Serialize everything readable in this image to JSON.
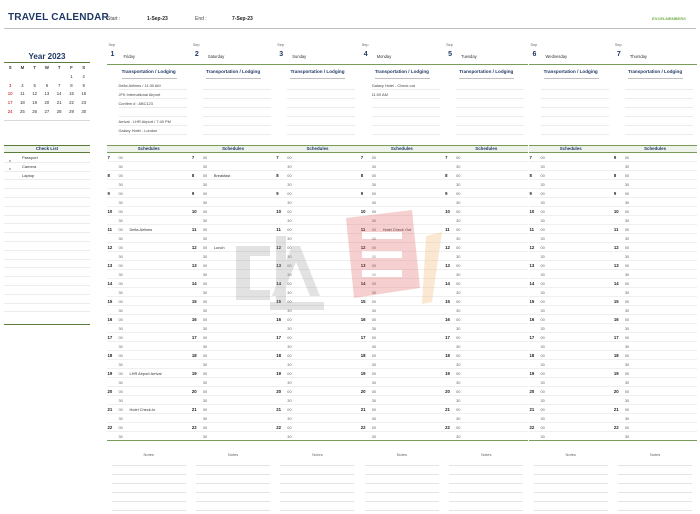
{
  "header": {
    "title": "TRAVEL CALENDAR",
    "start_label": "Start :",
    "start_value": "1-Sep-23",
    "end_label": "End :",
    "end_value": "7-Sep-23",
    "brand": "EXCELMEMBERS"
  },
  "minical": {
    "title": "Year 2023",
    "dow": [
      "S",
      "M",
      "T",
      "W",
      "T",
      "F",
      "S"
    ],
    "weeks": [
      [
        "",
        "",
        "",
        "",
        "",
        "1",
        "2"
      ],
      [
        "3",
        "4",
        "5",
        "6",
        "7",
        "8",
        "9"
      ],
      [
        "10",
        "11",
        "12",
        "13",
        "14",
        "15",
        "16"
      ],
      [
        "17",
        "18",
        "19",
        "20",
        "21",
        "22",
        "23"
      ],
      [
        "24",
        "25",
        "26",
        "27",
        "28",
        "29",
        "30"
      ]
    ]
  },
  "checklist": {
    "title": "Check List",
    "items": [
      {
        "mark": "x",
        "text": "Passport"
      },
      {
        "mark": "x",
        "text": "Camera"
      },
      {
        "mark": "",
        "text": "Laptop"
      }
    ]
  },
  "labels": {
    "transport": "Transportation / Lodging",
    "schedules": "Schedules",
    "notes": "Notes"
  },
  "days": [
    {
      "month": "Sep",
      "num": "1",
      "name": "Friday",
      "transport": [
        "Delta Airlines / 11:30 AM",
        "JFK International Airport",
        "Confirm # : ABC123",
        "",
        "Arrival - LHR Airport / 7:40 PM",
        "Galaxy Hotel - London"
      ],
      "hours": [
        [
          "7",
          "00",
          ""
        ],
        [
          "",
          "30",
          ""
        ],
        [
          "8",
          "00",
          ""
        ],
        [
          "",
          "30",
          ""
        ],
        [
          "9",
          "00",
          ""
        ],
        [
          "",
          "30",
          ""
        ],
        [
          "10",
          "00",
          ""
        ],
        [
          "",
          "30",
          ""
        ],
        [
          "11",
          "00",
          "Delta Airlines"
        ],
        [
          "",
          "30",
          ""
        ],
        [
          "12",
          "00",
          ""
        ],
        [
          "",
          "30",
          ""
        ],
        [
          "13",
          "00",
          ""
        ],
        [
          "",
          "30",
          ""
        ],
        [
          "14",
          "00",
          ""
        ],
        [
          "",
          "30",
          ""
        ],
        [
          "15",
          "00",
          ""
        ],
        [
          "",
          "30",
          ""
        ],
        [
          "16",
          "00",
          ""
        ],
        [
          "",
          "30",
          ""
        ],
        [
          "17",
          "00",
          ""
        ],
        [
          "",
          "30",
          ""
        ],
        [
          "18",
          "00",
          ""
        ],
        [
          "",
          "30",
          ""
        ],
        [
          "19",
          "00",
          "LHR Airport Arrival"
        ],
        [
          "",
          "30",
          ""
        ],
        [
          "20",
          "00",
          ""
        ],
        [
          "",
          "30",
          ""
        ],
        [
          "21",
          "00",
          "Hotel Check-In"
        ],
        [
          "",
          "30",
          ""
        ],
        [
          "22",
          "00",
          ""
        ],
        [
          "",
          "30",
          ""
        ]
      ]
    },
    {
      "month": "Sep",
      "num": "2",
      "name": "Saturday",
      "transport": [
        "",
        "",
        "",
        "",
        "",
        ""
      ],
      "hours": [
        [
          "7",
          "00",
          ""
        ],
        [
          "",
          "30",
          ""
        ],
        [
          "8",
          "00",
          "Breakfast"
        ],
        [
          "",
          "30",
          ""
        ],
        [
          "9",
          "00",
          ""
        ],
        [
          "",
          "30",
          ""
        ],
        [
          "10",
          "00",
          ""
        ],
        [
          "",
          "30",
          ""
        ],
        [
          "11",
          "00",
          ""
        ],
        [
          "",
          "30",
          ""
        ],
        [
          "12",
          "00",
          "Lunch"
        ],
        [
          "",
          "30",
          ""
        ],
        [
          "13",
          "00",
          ""
        ],
        [
          "",
          "30",
          ""
        ],
        [
          "14",
          "00",
          ""
        ],
        [
          "",
          "30",
          ""
        ],
        [
          "15",
          "00",
          ""
        ],
        [
          "",
          "30",
          ""
        ],
        [
          "16",
          "00",
          ""
        ],
        [
          "",
          "30",
          ""
        ],
        [
          "17",
          "00",
          ""
        ],
        [
          "",
          "30",
          ""
        ],
        [
          "18",
          "00",
          ""
        ],
        [
          "",
          "30",
          ""
        ],
        [
          "19",
          "00",
          ""
        ],
        [
          "",
          "30",
          ""
        ],
        [
          "20",
          "00",
          ""
        ],
        [
          "",
          "30",
          ""
        ],
        [
          "21",
          "00",
          ""
        ],
        [
          "",
          "30",
          ""
        ],
        [
          "22",
          "00",
          ""
        ],
        [
          "",
          "30",
          ""
        ]
      ]
    },
    {
      "month": "Sep",
      "num": "3",
      "name": "Sunday",
      "transport": [
        "",
        "",
        "",
        "",
        "",
        ""
      ],
      "hours": [
        [
          "7",
          "00",
          ""
        ],
        [
          "",
          "30",
          ""
        ],
        [
          "8",
          "00",
          ""
        ],
        [
          "",
          "30",
          ""
        ],
        [
          "9",
          "00",
          ""
        ],
        [
          "",
          "30",
          ""
        ],
        [
          "10",
          "00",
          ""
        ],
        [
          "",
          "30",
          ""
        ],
        [
          "11",
          "00",
          ""
        ],
        [
          "",
          "30",
          ""
        ],
        [
          "12",
          "00",
          ""
        ],
        [
          "",
          "30",
          ""
        ],
        [
          "13",
          "00",
          ""
        ],
        [
          "",
          "30",
          ""
        ],
        [
          "14",
          "00",
          ""
        ],
        [
          "",
          "30",
          ""
        ],
        [
          "15",
          "00",
          ""
        ],
        [
          "",
          "30",
          ""
        ],
        [
          "16",
          "00",
          ""
        ],
        [
          "",
          "30",
          ""
        ],
        [
          "17",
          "00",
          ""
        ],
        [
          "",
          "30",
          ""
        ],
        [
          "18",
          "00",
          ""
        ],
        [
          "",
          "30",
          ""
        ],
        [
          "19",
          "00",
          ""
        ],
        [
          "",
          "30",
          ""
        ],
        [
          "20",
          "00",
          ""
        ],
        [
          "",
          "30",
          ""
        ],
        [
          "21",
          "00",
          ""
        ],
        [
          "",
          "30",
          ""
        ],
        [
          "22",
          "00",
          ""
        ],
        [
          "",
          "30",
          ""
        ]
      ]
    },
    {
      "month": "Sep",
      "num": "4",
      "name": "Monday",
      "transport": [
        "Galaxy Hotel - Check out",
        "11:00 AM",
        "",
        "",
        "",
        ""
      ],
      "hours": [
        [
          "7",
          "00",
          ""
        ],
        [
          "",
          "30",
          ""
        ],
        [
          "8",
          "00",
          ""
        ],
        [
          "",
          "30",
          ""
        ],
        [
          "9",
          "00",
          ""
        ],
        [
          "",
          "30",
          ""
        ],
        [
          "10",
          "00",
          ""
        ],
        [
          "",
          "30",
          ""
        ],
        [
          "11",
          "00",
          "Hotel Check Out"
        ],
        [
          "",
          "30",
          ""
        ],
        [
          "12",
          "00",
          ""
        ],
        [
          "",
          "30",
          ""
        ],
        [
          "13",
          "00",
          ""
        ],
        [
          "",
          "30",
          ""
        ],
        [
          "14",
          "00",
          ""
        ],
        [
          "",
          "30",
          ""
        ],
        [
          "15",
          "00",
          ""
        ],
        [
          "",
          "30",
          ""
        ],
        [
          "16",
          "00",
          ""
        ],
        [
          "",
          "30",
          ""
        ],
        [
          "17",
          "00",
          ""
        ],
        [
          "",
          "30",
          ""
        ],
        [
          "18",
          "00",
          ""
        ],
        [
          "",
          "30",
          ""
        ],
        [
          "19",
          "00",
          ""
        ],
        [
          "",
          "30",
          ""
        ],
        [
          "20",
          "00",
          ""
        ],
        [
          "",
          "30",
          ""
        ],
        [
          "21",
          "00",
          ""
        ],
        [
          "",
          "30",
          ""
        ],
        [
          "22",
          "00",
          ""
        ],
        [
          "",
          "30",
          ""
        ]
      ]
    },
    {
      "month": "Sep",
      "num": "5",
      "name": "Tuesday",
      "transport": [
        "",
        "",
        "",
        "",
        "",
        ""
      ],
      "hours": [
        [
          "7",
          "00",
          ""
        ],
        [
          "",
          "30",
          ""
        ],
        [
          "8",
          "00",
          ""
        ],
        [
          "",
          "30",
          ""
        ],
        [
          "9",
          "00",
          ""
        ],
        [
          "",
          "30",
          ""
        ],
        [
          "10",
          "00",
          ""
        ],
        [
          "",
          "30",
          ""
        ],
        [
          "11",
          "00",
          ""
        ],
        [
          "",
          "30",
          ""
        ],
        [
          "12",
          "00",
          ""
        ],
        [
          "",
          "30",
          ""
        ],
        [
          "13",
          "00",
          ""
        ],
        [
          "",
          "30",
          ""
        ],
        [
          "14",
          "00",
          ""
        ],
        [
          "",
          "30",
          ""
        ],
        [
          "15",
          "00",
          ""
        ],
        [
          "",
          "30",
          ""
        ],
        [
          "16",
          "00",
          ""
        ],
        [
          "",
          "30",
          ""
        ],
        [
          "17",
          "00",
          ""
        ],
        [
          "",
          "30",
          ""
        ],
        [
          "18",
          "00",
          ""
        ],
        [
          "",
          "30",
          ""
        ],
        [
          "19",
          "00",
          ""
        ],
        [
          "",
          "30",
          ""
        ],
        [
          "20",
          "00",
          ""
        ],
        [
          "",
          "30",
          ""
        ],
        [
          "21",
          "00",
          ""
        ],
        [
          "",
          "30",
          ""
        ],
        [
          "22",
          "00",
          ""
        ],
        [
          "",
          "30",
          ""
        ]
      ]
    },
    {
      "month": "Sep",
      "num": "6",
      "name": "Wednesday",
      "transport": [
        "",
        "",
        "",
        "",
        "",
        ""
      ],
      "hours": [
        [
          "7",
          "00",
          ""
        ],
        [
          "",
          "30",
          ""
        ],
        [
          "8",
          "00",
          ""
        ],
        [
          "",
          "30",
          ""
        ],
        [
          "9",
          "00",
          ""
        ],
        [
          "",
          "30",
          ""
        ],
        [
          "10",
          "00",
          ""
        ],
        [
          "",
          "30",
          ""
        ],
        [
          "11",
          "00",
          ""
        ],
        [
          "",
          "30",
          ""
        ],
        [
          "12",
          "00",
          ""
        ],
        [
          "",
          "30",
          ""
        ],
        [
          "13",
          "00",
          ""
        ],
        [
          "",
          "30",
          ""
        ],
        [
          "14",
          "00",
          ""
        ],
        [
          "",
          "30",
          ""
        ],
        [
          "15",
          "00",
          ""
        ],
        [
          "",
          "30",
          ""
        ],
        [
          "16",
          "00",
          ""
        ],
        [
          "",
          "30",
          ""
        ],
        [
          "17",
          "00",
          ""
        ],
        [
          "",
          "30",
          ""
        ],
        [
          "18",
          "00",
          ""
        ],
        [
          "",
          "30",
          ""
        ],
        [
          "19",
          "00",
          ""
        ],
        [
          "",
          "30",
          ""
        ],
        [
          "20",
          "00",
          ""
        ],
        [
          "",
          "30",
          ""
        ],
        [
          "21",
          "00",
          ""
        ],
        [
          "",
          "30",
          ""
        ],
        [
          "22",
          "00",
          ""
        ],
        [
          "",
          "30",
          ""
        ]
      ]
    },
    {
      "month": "Sep",
      "num": "7",
      "name": "Thursday",
      "transport": [
        "",
        "",
        "",
        "",
        "",
        ""
      ],
      "hours": [
        [
          "9",
          "00",
          ""
        ],
        [
          "",
          "30",
          ""
        ],
        [
          "8",
          "00",
          ""
        ],
        [
          "",
          "30",
          ""
        ],
        [
          "9",
          "00",
          ""
        ],
        [
          "",
          "30",
          ""
        ],
        [
          "10",
          "00",
          ""
        ],
        [
          "",
          "30",
          ""
        ],
        [
          "11",
          "00",
          ""
        ],
        [
          "",
          "30",
          ""
        ],
        [
          "12",
          "00",
          ""
        ],
        [
          "",
          "30",
          ""
        ],
        [
          "13",
          "00",
          ""
        ],
        [
          "",
          "30",
          ""
        ],
        [
          "14",
          "00",
          ""
        ],
        [
          "",
          "30",
          ""
        ],
        [
          "15",
          "00",
          ""
        ],
        [
          "",
          "30",
          ""
        ],
        [
          "16",
          "00",
          ""
        ],
        [
          "",
          "30",
          ""
        ],
        [
          "17",
          "00",
          ""
        ],
        [
          "",
          "30",
          ""
        ],
        [
          "18",
          "00",
          ""
        ],
        [
          "",
          "30",
          ""
        ],
        [
          "19",
          "00",
          ""
        ],
        [
          "",
          "30",
          ""
        ],
        [
          "20",
          "00",
          ""
        ],
        [
          "",
          "30",
          ""
        ],
        [
          "21",
          "00",
          ""
        ],
        [
          "",
          "30",
          ""
        ],
        [
          "22",
          "00",
          ""
        ],
        [
          "",
          "30",
          ""
        ]
      ]
    }
  ]
}
